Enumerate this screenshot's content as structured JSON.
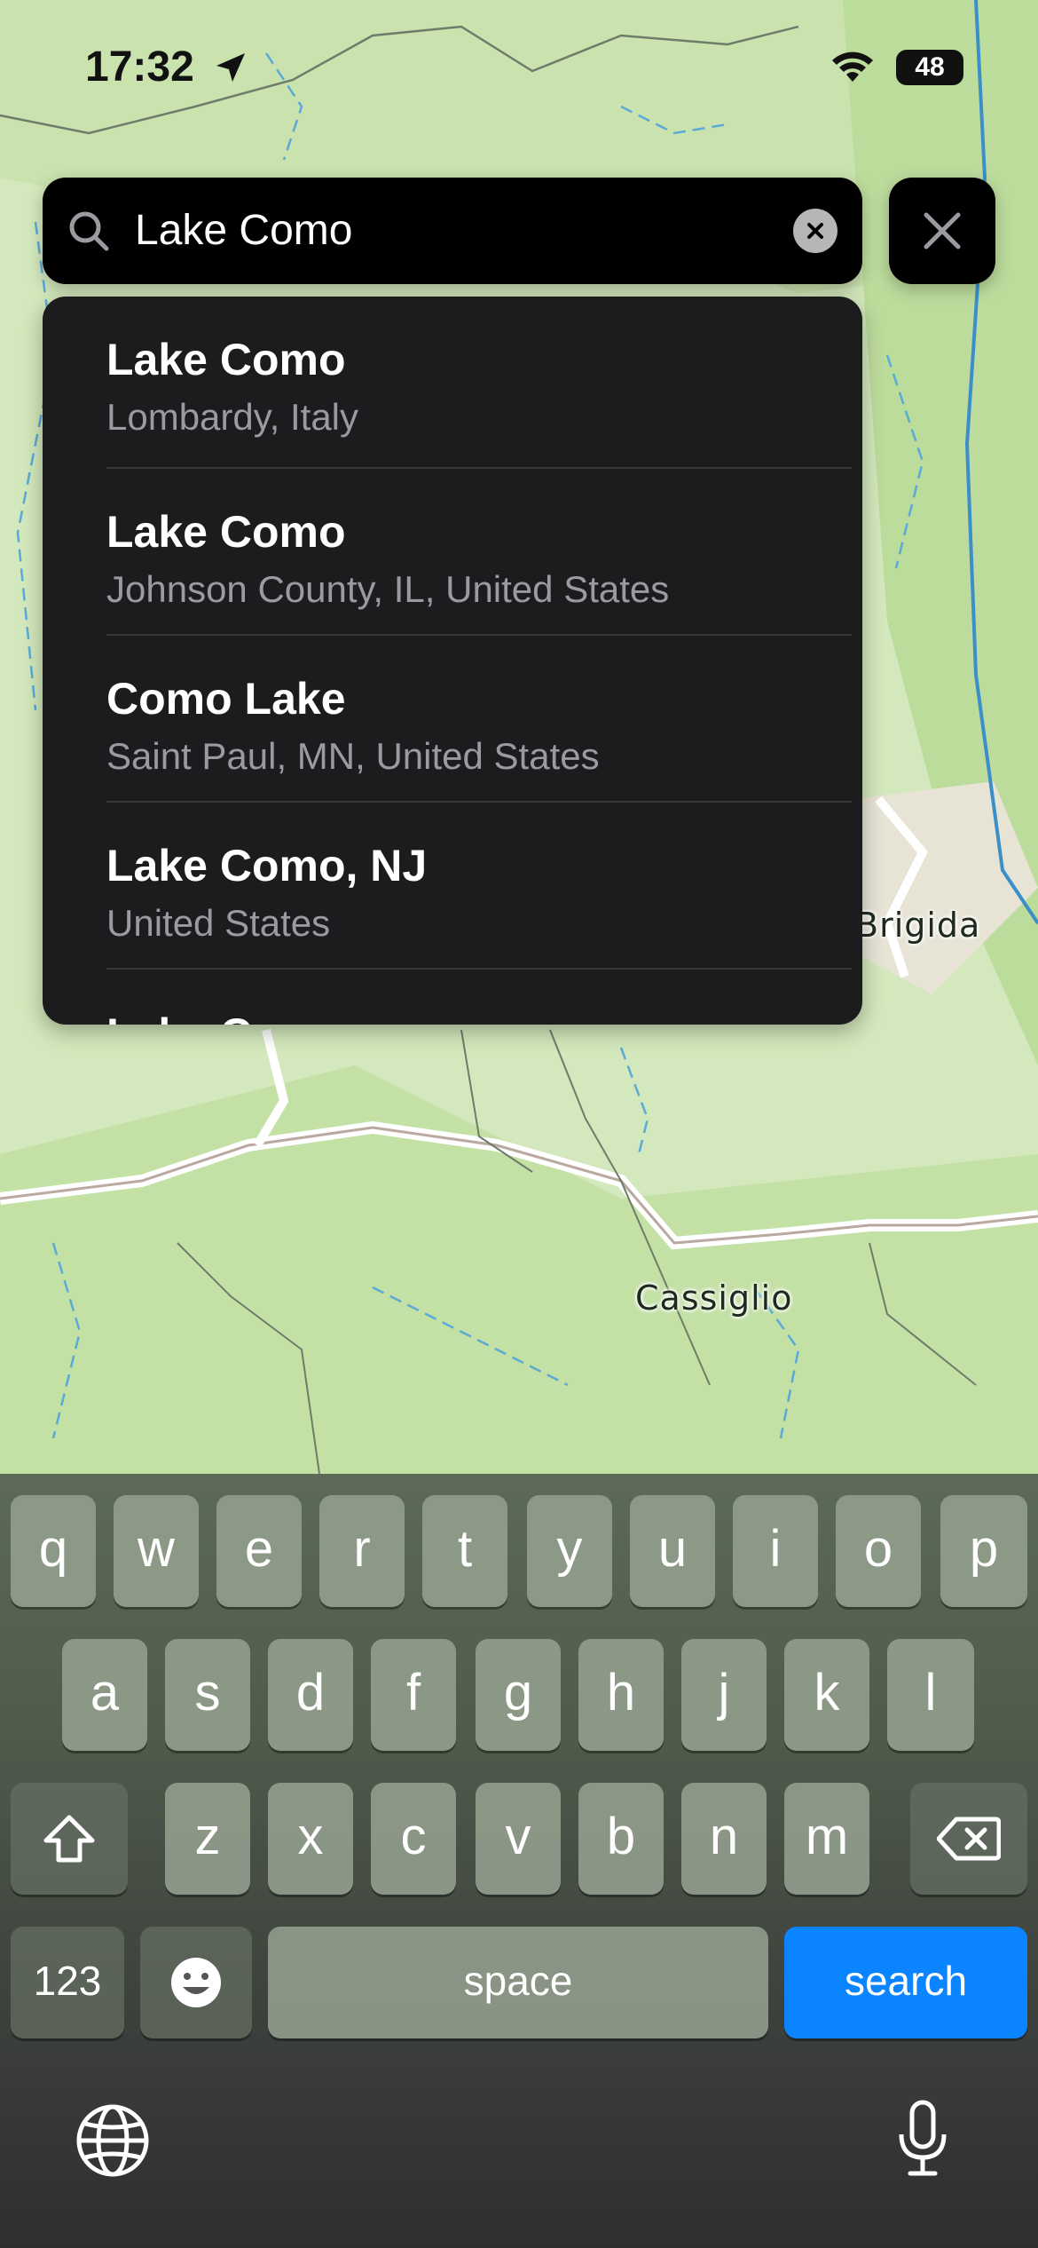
{
  "status_bar": {
    "time": "17:32",
    "battery": "48"
  },
  "map": {
    "labels": [
      "Brigida",
      "Cassiglio"
    ]
  },
  "search": {
    "query": "Lake Como"
  },
  "results": [
    {
      "title": "Lake Como",
      "subtitle": "Lombardy, Italy"
    },
    {
      "title": "Lake Como",
      "subtitle": "Johnson County, IL, United States"
    },
    {
      "title": "Como Lake",
      "subtitle": "Saint Paul, MN, United States"
    },
    {
      "title": "Lake Como, NJ",
      "subtitle": "United States"
    },
    {
      "title": "Lake Como",
      "subtitle": ""
    }
  ],
  "keyboard": {
    "row1": [
      "q",
      "w",
      "e",
      "r",
      "t",
      "y",
      "u",
      "i",
      "o",
      "p"
    ],
    "row2": [
      "a",
      "s",
      "d",
      "f",
      "g",
      "h",
      "j",
      "k",
      "l"
    ],
    "row3": [
      "z",
      "x",
      "c",
      "v",
      "b",
      "n",
      "m"
    ],
    "numbers_label": "123",
    "space_label": "space",
    "search_label": "search",
    "icons": [
      "shift-icon",
      "delete-icon",
      "emoji-icon",
      "globe-icon",
      "microphone-icon"
    ]
  },
  "colors": {
    "accent": "#0a84ff",
    "panel": "#1c1c1e",
    "map_bg": "#cfe6b4"
  }
}
